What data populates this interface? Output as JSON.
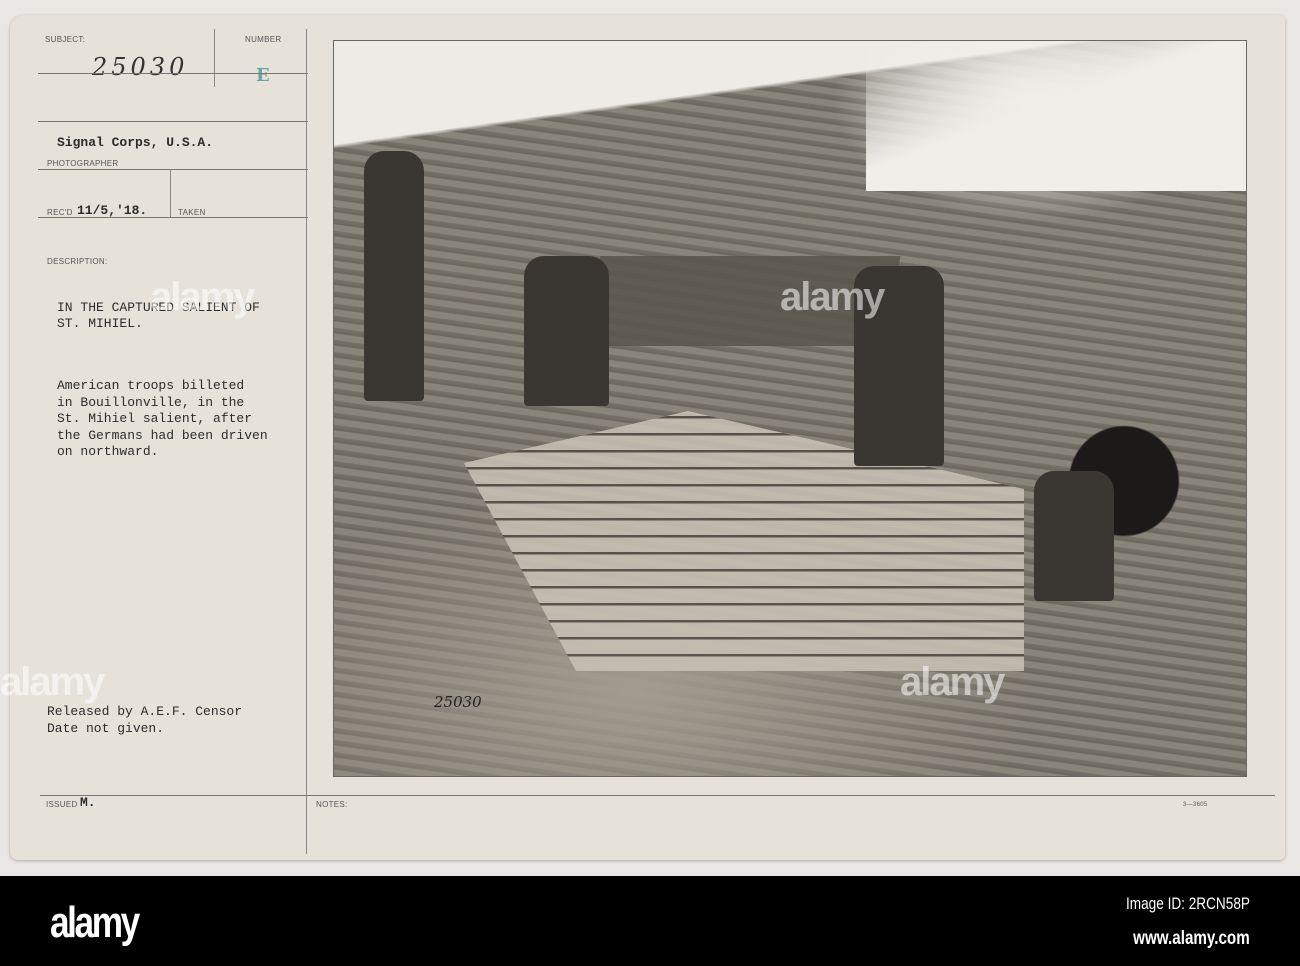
{
  "card": {
    "subject_label": "SUBJECT:",
    "subject_value": "25030",
    "number_label": "NUMBER",
    "number_stamp": "E",
    "photographer_value": "Signal Corps, U.S.A.",
    "photographer_label": "PHOTOGRAPHER",
    "recd_label": "REC'D",
    "recd_value": "11/5,'18.",
    "taken_label": "TAKEN",
    "description_label": "DESCRIPTION:",
    "description_title": "IN THE CAPTURED SALIENT OF\nST. MIHIEL.",
    "description_body": "American troops billeted\nin Bouillonville, in the\nSt. Mihiel salient, after\nthe Germans had been driven\non northward.",
    "release_note": "Released by A.E.F. Censor\nDate not given.",
    "issued_label": "ISSUED",
    "issued_value": "M.",
    "notes_label": "NOTES:",
    "form_number": "3—3605",
    "photo_number": "25030"
  },
  "watermark": {
    "logo": "alamy",
    "image_id": "Image ID: 2RCN58P",
    "site": "www.alamy.com"
  }
}
